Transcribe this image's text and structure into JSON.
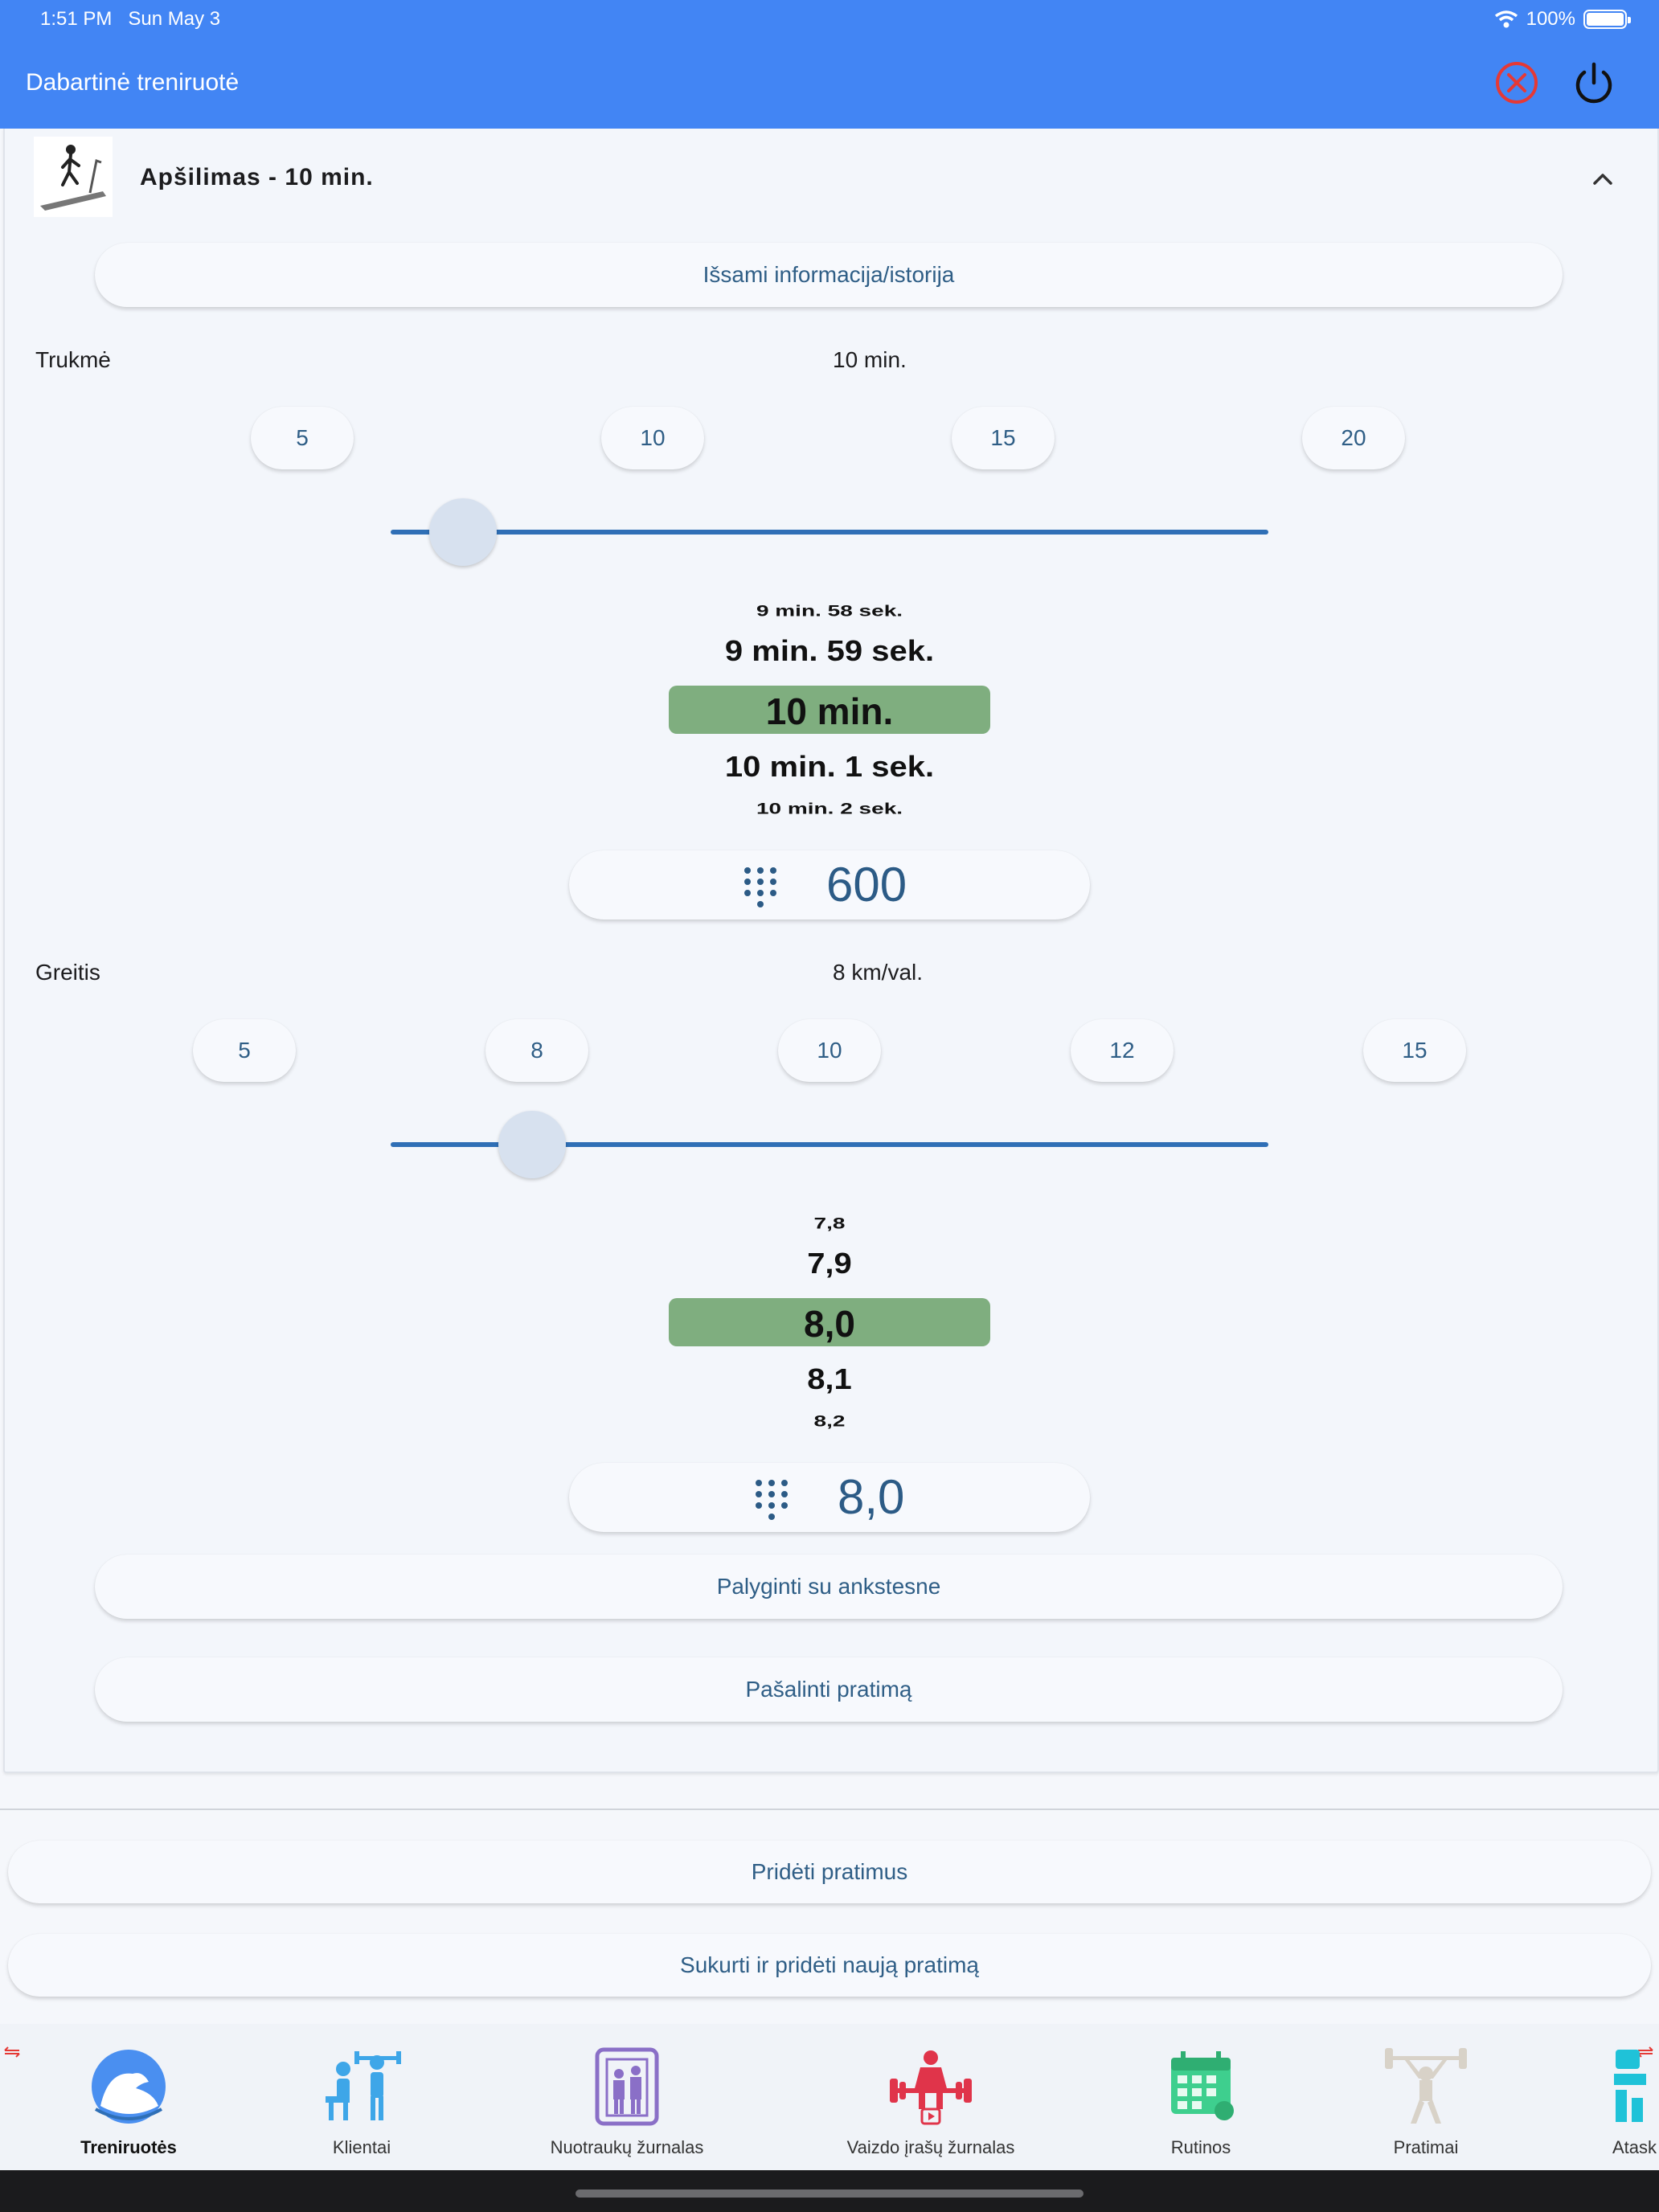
{
  "status_bar": {
    "time": "1:51 PM",
    "date": "Sun May 3",
    "battery": "100%"
  },
  "header": {
    "title": "Dabartinė treniruotė"
  },
  "exercise": {
    "title": "Apšilimas - 10 min.",
    "details_button": "Išsami informacija/istorija",
    "duration": {
      "label": "Trukmė",
      "value_text": "10 min.",
      "presets": [
        "5",
        "10",
        "15",
        "20"
      ],
      "slider_value": 10,
      "wheel": [
        "9 min. 58 sek.",
        "9 min. 59 sek.",
        "10 min.",
        "10 min. 1 sek.",
        "10 min. 2 sek."
      ],
      "numeric": "600"
    },
    "speed": {
      "label": "Greitis",
      "value_text": "8 km/val.",
      "presets": [
        "5",
        "8",
        "10",
        "12",
        "15"
      ],
      "slider_value": 8,
      "wheel": [
        "7,8",
        "7,9",
        "8,0",
        "8,1",
        "8,2"
      ],
      "numeric": "8,0"
    },
    "compare_button": "Palyginti su ankstesne",
    "remove_button": "Pašalinti pratimą"
  },
  "actions": {
    "add_exercises": "Pridėti pratimus",
    "create_exercise": "Sukurti ir pridėti naują pratimą"
  },
  "tabs": [
    {
      "label": "Treniruotės",
      "icon": "muscle-icon",
      "active": true
    },
    {
      "label": "Klientai",
      "icon": "trainer-clients-icon",
      "active": false
    },
    {
      "label": "Nuotraukų žurnalas",
      "icon": "photo-journal-icon",
      "active": false
    },
    {
      "label": "Vaizdo įrašų žurnalas",
      "icon": "video-journal-icon",
      "active": false
    },
    {
      "label": "Rutinos",
      "icon": "calendar-icon",
      "active": false
    },
    {
      "label": "Pratimai",
      "icon": "weightlifter-icon",
      "active": false
    },
    {
      "label": "Atask",
      "icon": "reports-icon",
      "active": false
    }
  ],
  "colors": {
    "header": "#4285f4",
    "accent": "#2f6fb6",
    "selection": "#7fae7f",
    "close": "#e53935"
  }
}
